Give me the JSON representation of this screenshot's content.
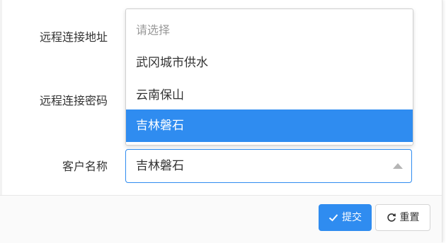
{
  "form": {
    "labels": {
      "remote_address": "远程连接地址",
      "remote_password": "远程连接密码",
      "customer_name": "客户名称"
    },
    "customer_select": {
      "selected": "吉林磐石",
      "options": [
        "请选择",
        "武冈城市供水",
        "云南保山",
        "吉林磐石"
      ]
    }
  },
  "footer": {
    "submit_label": "提交",
    "reset_label": "重置"
  },
  "colors": {
    "accent": "#2f8cf0"
  },
  "icons": {
    "select_caret": "caret-up-icon",
    "submit": "check-icon",
    "reset": "refresh-icon"
  }
}
